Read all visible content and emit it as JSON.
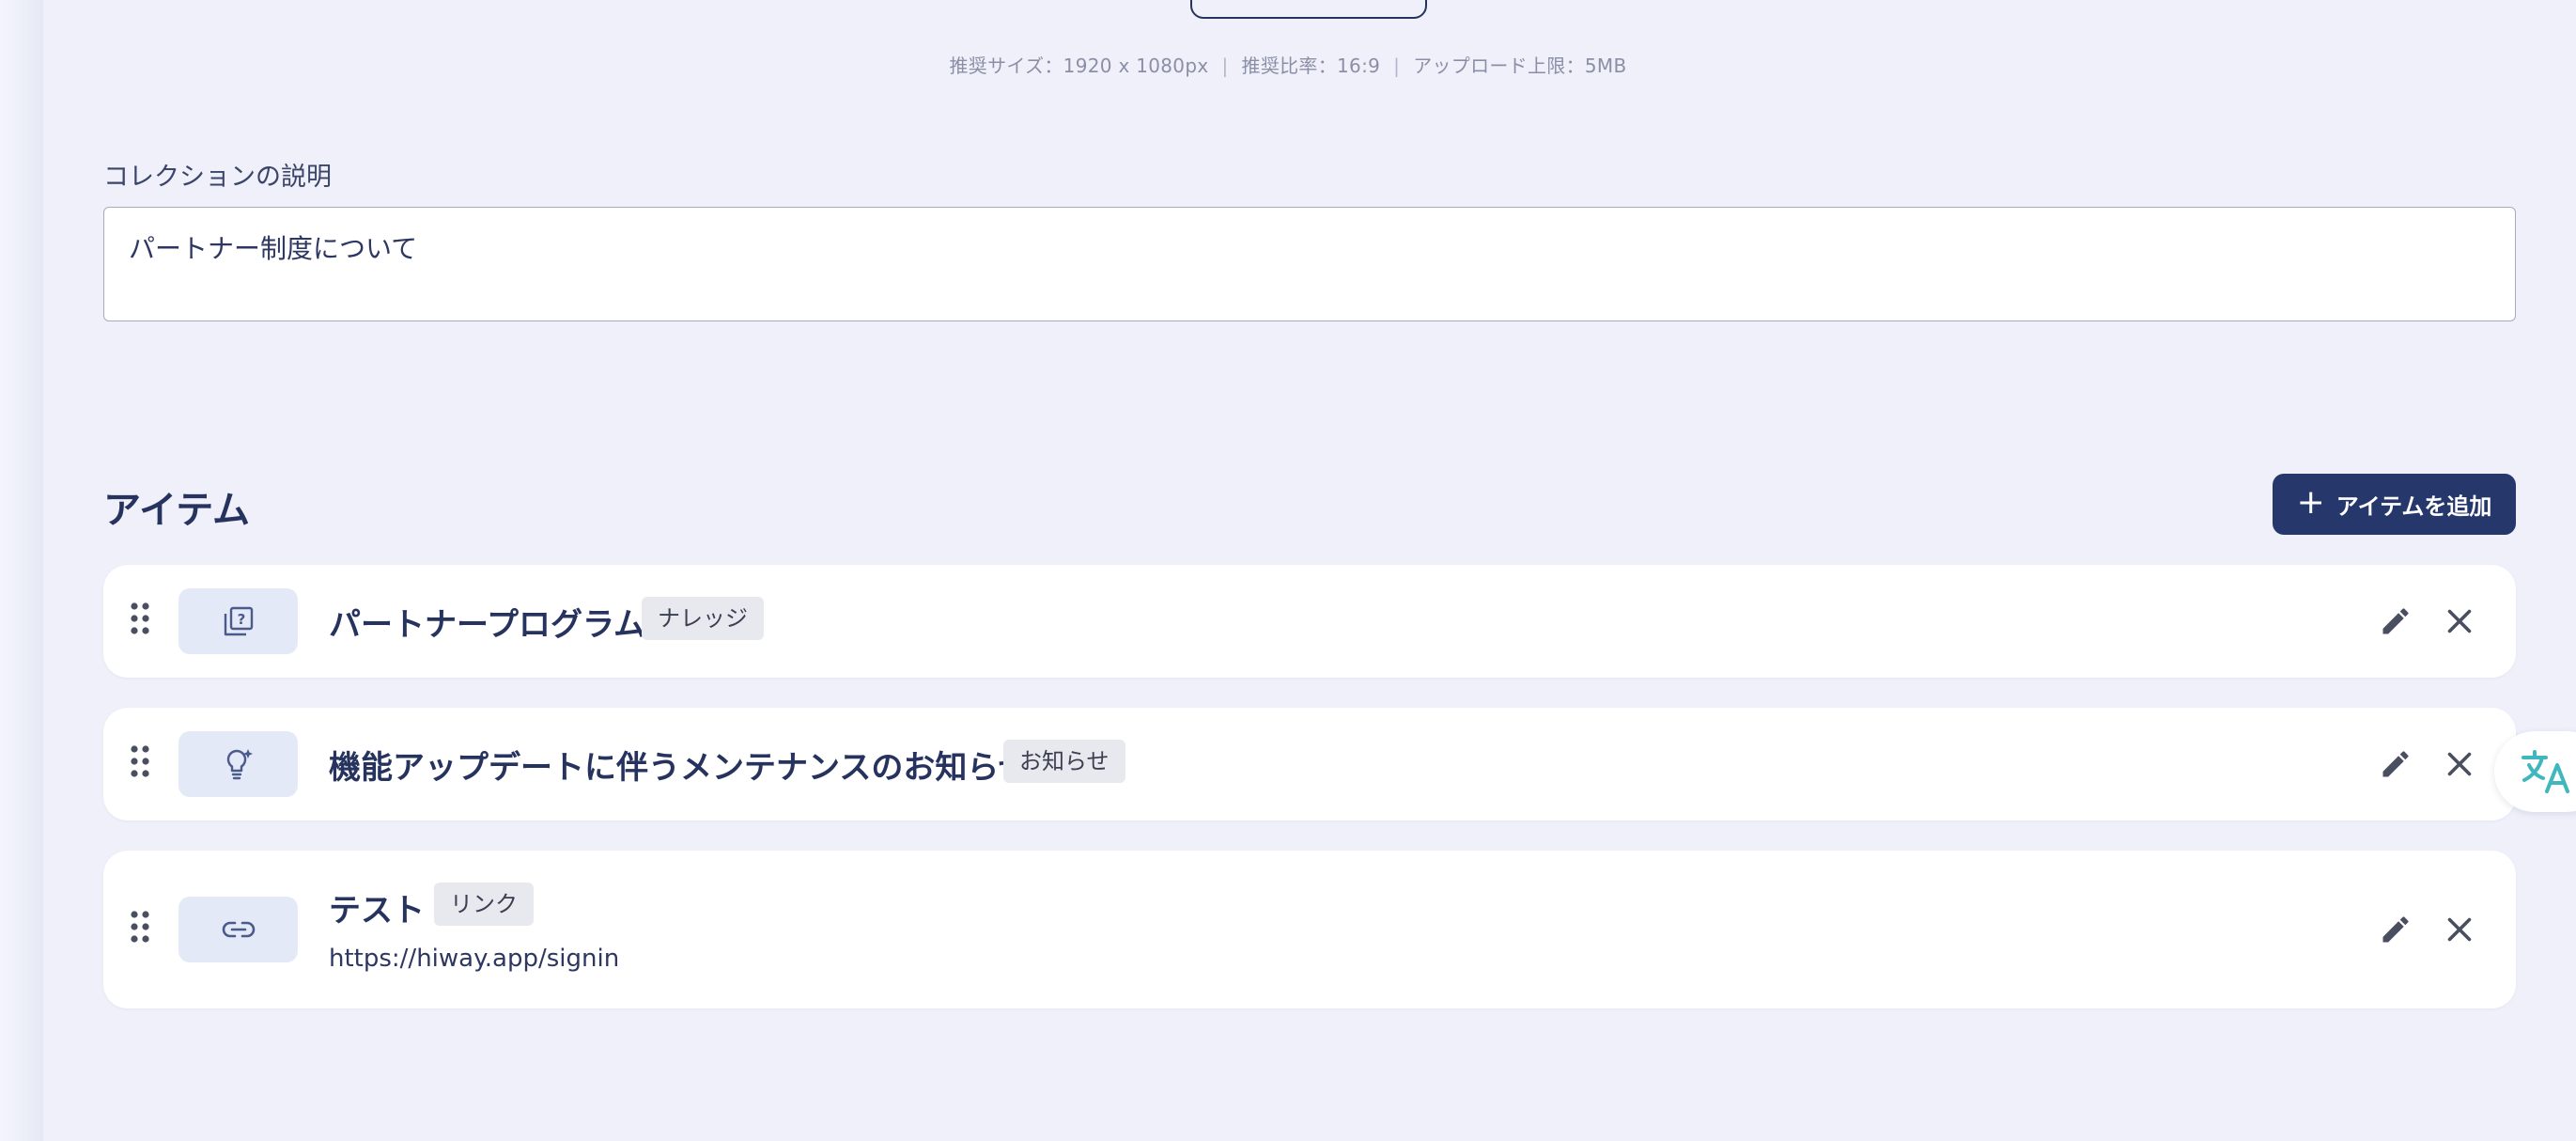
{
  "upload": {
    "hint_size": "推奨サイズ：1920 x 1080px",
    "hint_ratio": "推奨比率：16:9",
    "hint_limit": "アップロード上限：5MB",
    "separator": "|"
  },
  "description": {
    "label": "コレクションの説明",
    "value": "パートナー制度について"
  },
  "items_section": {
    "title": "アイテム",
    "add_button_label": "アイテムを追加",
    "add_button_icon": "plus-icon",
    "items": [
      {
        "title": "パートナープログラム",
        "tag": "ナレッジ",
        "icon": "knowledge-question-icon",
        "url": ""
      },
      {
        "title": "機能アップデートに伴うメンテナンスのお知らせ",
        "tag": "お知らせ",
        "icon": "lightbulb-icon",
        "url": ""
      },
      {
        "title": "テスト",
        "tag": "リンク",
        "icon": "link-icon",
        "url": "https://hiway.app/signin"
      }
    ]
  },
  "colors": {
    "primary": "#25376b",
    "background": "#eff0fa",
    "thumb_bg": "#e4e9f8",
    "tag_bg": "#e8e9ef",
    "translate_accent": "#3fb8bd"
  }
}
